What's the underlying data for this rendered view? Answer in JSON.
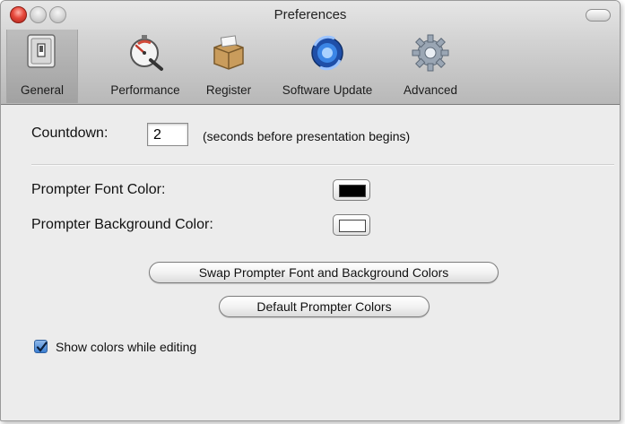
{
  "window": {
    "title": "Preferences"
  },
  "toolbar": {
    "items": [
      {
        "label": "General",
        "icon": "switch-icon"
      },
      {
        "label": "Performance",
        "icon": "stopwatch-icon"
      },
      {
        "label": "Register",
        "icon": "package-icon"
      },
      {
        "label": "Software Update",
        "icon": "update-icon"
      },
      {
        "label": "Advanced",
        "icon": "gear-icon"
      }
    ],
    "selected": "General"
  },
  "countdown": {
    "label": "Countdown:",
    "value": "2",
    "hint": "(seconds before presentation begins)"
  },
  "colors": {
    "font_label": "Prompter Font Color:",
    "font_color": "#000000",
    "background_label": "Prompter Background Color:",
    "background_color": "#ffffff"
  },
  "buttons": {
    "swap": "Swap Prompter Font and Background Colors",
    "default": "Default Prompter Colors"
  },
  "show_colors": {
    "label": "Show colors while editing",
    "checked": true
  }
}
